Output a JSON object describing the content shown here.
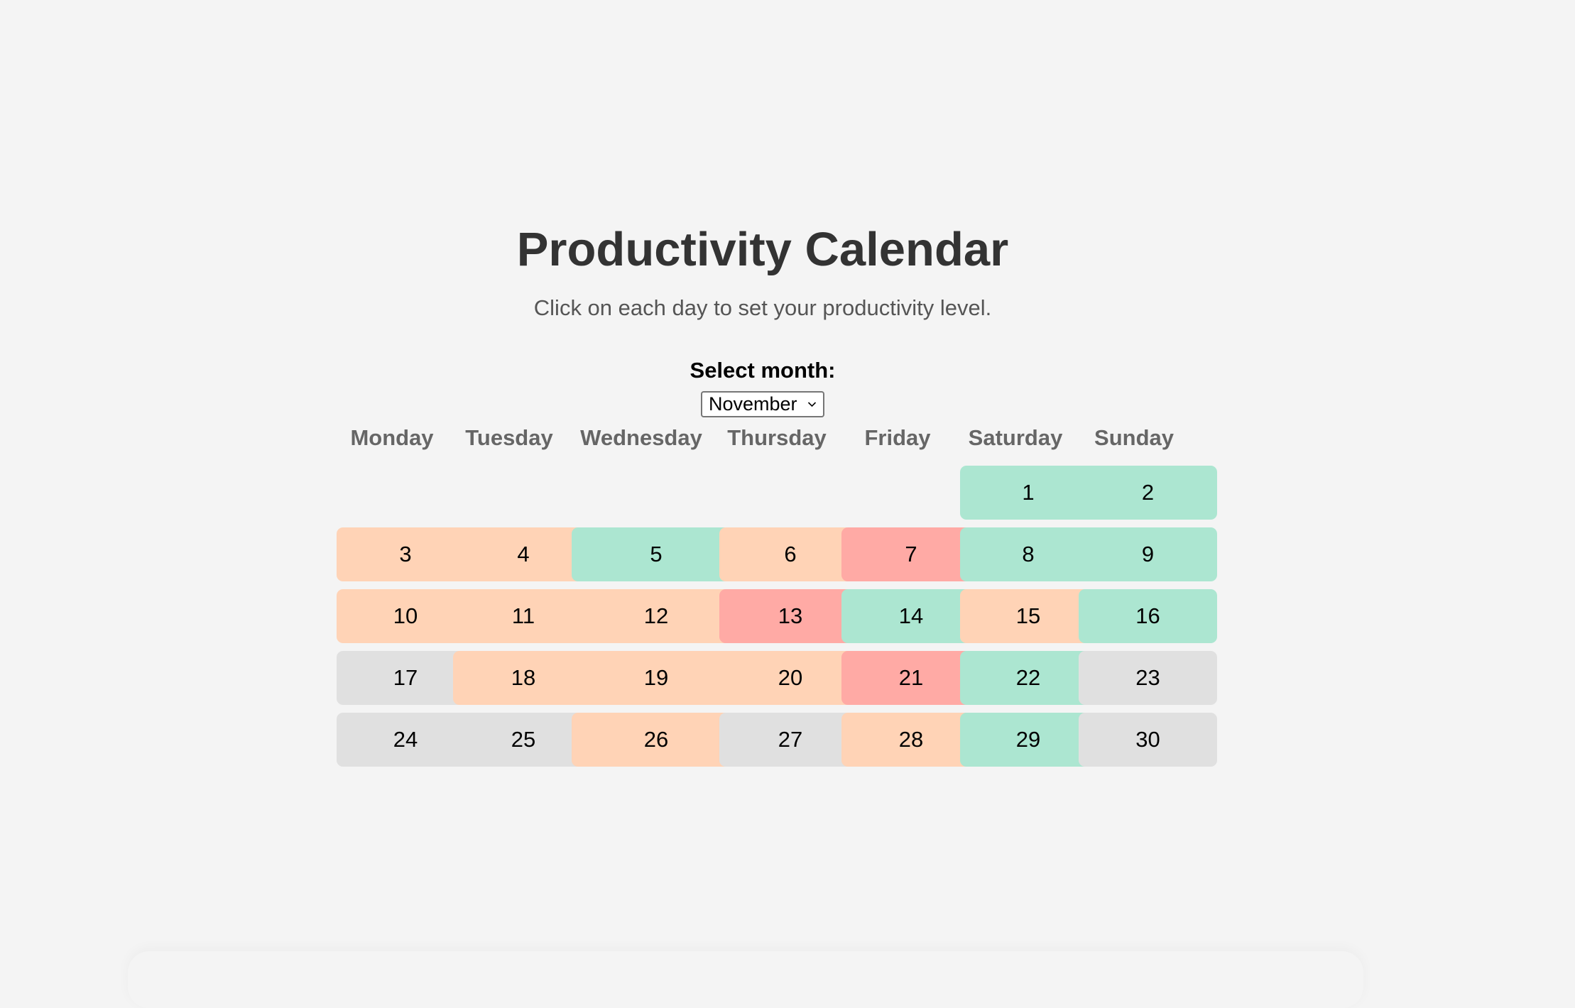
{
  "header": {
    "title": "Productivity Calendar",
    "subtitle": "Click on each day to set your productivity level."
  },
  "month_selector": {
    "label": "Select month:",
    "selected": "November"
  },
  "weekdays": [
    "Monday",
    "Tuesday",
    "Wednesday",
    "Thursday",
    "Friday",
    "Saturday",
    "Sunday"
  ],
  "levels": {
    "high": "#ace6d1",
    "medium": "#ffd3b6",
    "low": "#ffaaa5",
    "none": "#e0e0e0"
  },
  "calendar": {
    "first_weekday_index": 5,
    "days": [
      {
        "day": "1",
        "level": "high"
      },
      {
        "day": "2",
        "level": "high"
      },
      {
        "day": "3",
        "level": "medium"
      },
      {
        "day": "4",
        "level": "medium"
      },
      {
        "day": "5",
        "level": "high"
      },
      {
        "day": "6",
        "level": "medium"
      },
      {
        "day": "7",
        "level": "low"
      },
      {
        "day": "8",
        "level": "high"
      },
      {
        "day": "9",
        "level": "high"
      },
      {
        "day": "10",
        "level": "medium"
      },
      {
        "day": "11",
        "level": "medium"
      },
      {
        "day": "12",
        "level": "medium"
      },
      {
        "day": "13",
        "level": "low"
      },
      {
        "day": "14",
        "level": "high"
      },
      {
        "day": "15",
        "level": "medium"
      },
      {
        "day": "16",
        "level": "high"
      },
      {
        "day": "17",
        "level": "none"
      },
      {
        "day": "18",
        "level": "medium"
      },
      {
        "day": "19",
        "level": "medium"
      },
      {
        "day": "20",
        "level": "medium"
      },
      {
        "day": "21",
        "level": "low"
      },
      {
        "day": "22",
        "level": "high"
      },
      {
        "day": "23",
        "level": "none"
      },
      {
        "day": "24",
        "level": "none"
      },
      {
        "day": "25",
        "level": "none"
      },
      {
        "day": "26",
        "level": "medium"
      },
      {
        "day": "27",
        "level": "none"
      },
      {
        "day": "28",
        "level": "medium"
      },
      {
        "day": "29",
        "level": "high"
      },
      {
        "day": "30",
        "level": "none"
      }
    ]
  }
}
